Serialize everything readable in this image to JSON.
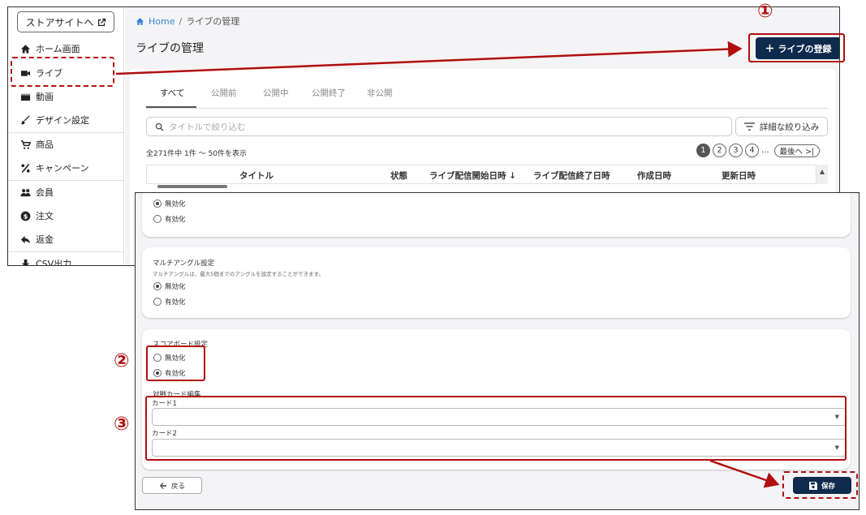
{
  "sidebar": {
    "store_button": "ストアサイトへ",
    "items": [
      {
        "label": "ホーム画面",
        "icon": "home-icon"
      },
      {
        "label": "ライブ",
        "icon": "video-camera-icon"
      },
      {
        "label": "動画",
        "icon": "movie-icon"
      },
      {
        "label": "デザイン設定",
        "icon": "brush-icon"
      },
      {
        "label": "商品",
        "icon": "cart-icon"
      },
      {
        "label": "キャンペーン",
        "icon": "percent-icon"
      },
      {
        "label": "会員",
        "icon": "people-icon"
      },
      {
        "label": "注文",
        "icon": "dollar-icon"
      },
      {
        "label": "返金",
        "icon": "reply-icon"
      },
      {
        "label": "CSV出力",
        "icon": "download-icon"
      }
    ]
  },
  "breadcrumb": {
    "home": "Home",
    "separator": "/",
    "current": "ライブの管理"
  },
  "page_title": "ライブの管理",
  "register_button": "ライブの登録",
  "tabs": [
    "すべて",
    "公開前",
    "公開中",
    "公開終了",
    "非公開"
  ],
  "search": {
    "placeholder": "タイトルで絞り込む"
  },
  "filter_button": "詳細な絞り込み",
  "result_count": "全271件中 1件 ～ 50件を表示",
  "pagination": {
    "pages": [
      "1",
      "2",
      "3",
      "4"
    ],
    "current": "1",
    "ellipsis": "...",
    "last": "最後へ >|"
  },
  "table_headers": [
    "タイトル",
    "状態",
    "ライブ配信開始日時 ↓",
    "ライブ配信終了日時",
    "作成日時",
    "更新日時"
  ],
  "form": {
    "section1": {
      "options": [
        "無効化",
        "有効化"
      ],
      "selected": "無効化"
    },
    "multi_angle": {
      "title": "マルチアングル設定",
      "description": "マルチアングルは、最大5個までのアングルを設定することができます。",
      "options": [
        "無効化",
        "有効化"
      ],
      "selected": "無効化"
    },
    "scoreboard": {
      "title": "スコアボード設定",
      "options": [
        "無効化",
        "有効化"
      ],
      "selected": "有効化",
      "match_card_title": "対戦カード編集",
      "card1_label": "カード1",
      "card2_label": "カード2"
    },
    "back_button": "戻る",
    "save_button": "保存"
  },
  "annotations": {
    "step1": "①",
    "step2": "②",
    "step3": "③"
  },
  "colors": {
    "accent_navy": "#0e2a4d",
    "annotation_red": "#b10e0e",
    "link_blue": "#3b82d6"
  }
}
